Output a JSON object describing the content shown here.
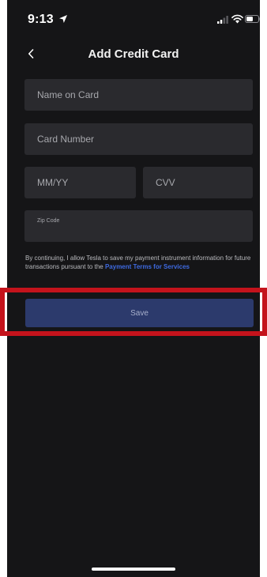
{
  "status_bar": {
    "time": "9:13",
    "icons": [
      "location-arrow-icon",
      "signal-icon",
      "wifi-icon",
      "battery-icon"
    ]
  },
  "header": {
    "back_icon": "chevron-left-icon",
    "title": "Add Credit Card"
  },
  "form": {
    "name_placeholder": "Name on Card",
    "card_placeholder": "Card Number",
    "expiry_placeholder": "MM/YY",
    "cvv_placeholder": "CVV",
    "zip_placeholder": "Zip Code",
    "name_value": "",
    "card_value": "",
    "expiry_value": "",
    "cvv_value": "",
    "zip_value": ""
  },
  "consent": {
    "text": "By continuing, I allow Tesla to save my payment instrument information for future transactions pursuant to the ",
    "link_label": "Payment Terms for Services"
  },
  "save_label": "Save",
  "colors": {
    "background": "#151517",
    "field_background": "#2a2a2e",
    "link": "#3e6ae1",
    "save_button": "#2c3a6c",
    "highlight": "#c4131c"
  }
}
